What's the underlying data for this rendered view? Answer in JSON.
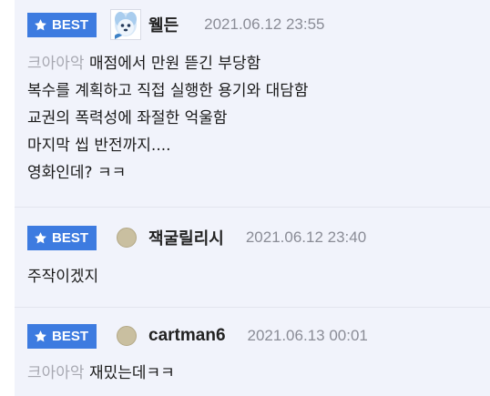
{
  "comments": [
    {
      "badge": "BEST",
      "nickname": "웰든",
      "date": "2021.06.12 23:55",
      "ref": "크아아악",
      "lines": [
        "매점에서 만원 뜯긴 부당함",
        "복수를 계획하고 직접 실행한 용기와 대담함",
        "교권의 폭력성에 좌절한 억울함",
        "마지막 씹 반전까지....",
        "영화인데? ㅋㅋ"
      ]
    },
    {
      "badge": "BEST",
      "nickname": "잭굴릴리시",
      "date": "2021.06.12 23:40",
      "lines": [
        "주작이겠지"
      ]
    },
    {
      "badge": "BEST",
      "nickname": "cartman6",
      "date": "2021.06.13 00:01",
      "ref": "크아아악",
      "lines": [
        "재밌는데ㅋㅋ"
      ]
    }
  ],
  "colors": {
    "badge": "#3d7be0",
    "background": "#f1f3fb",
    "date": "#8a8c96",
    "ref": "#a8a9b2"
  },
  "icons": {
    "badge_icon": "star-icon",
    "avatar_default": "avatar-circle-icon"
  }
}
